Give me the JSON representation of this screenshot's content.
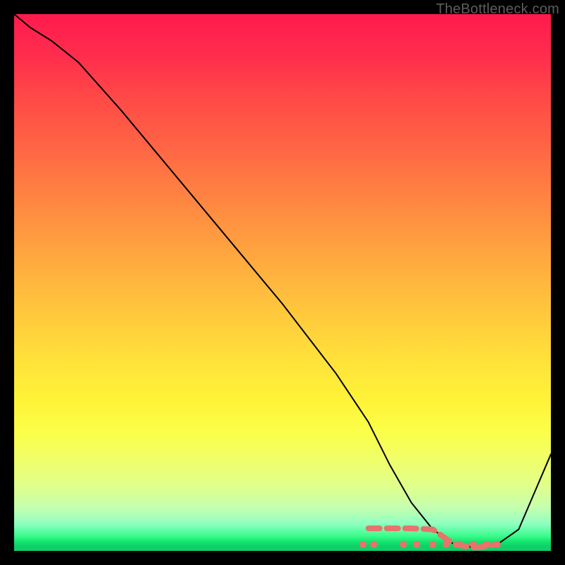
{
  "watermark": "TheBottleneck.com",
  "chart_data": {
    "type": "line",
    "title": "",
    "xlabel": "",
    "ylabel": "",
    "xlim": [
      0,
      100
    ],
    "ylim": [
      0,
      100
    ],
    "series": [
      {
        "name": "curve",
        "x": [
          0,
          3,
          7,
          12,
          20,
          30,
          40,
          50,
          60,
          66,
          70,
          74,
          78,
          82,
          86,
          90,
          94,
          100
        ],
        "y": [
          100,
          97.5,
          95,
          91,
          82,
          70,
          58,
          46,
          33,
          24,
          16,
          9,
          4,
          1.2,
          0.6,
          1.2,
          4,
          18
        ]
      }
    ],
    "highlight_range_x": [
      65,
      90
    ],
    "highlight_color": "#e8736b",
    "highlight_y": 1.2,
    "highlight_dots_x": [
      65,
      67,
      72.5,
      75,
      78,
      80.5,
      83,
      85.5,
      88,
      90
    ],
    "gradient_stops": [
      {
        "pct": 0,
        "color": "#ff1a4d"
      },
      {
        "pct": 50,
        "color": "#ffcc3c"
      },
      {
        "pct": 80,
        "color": "#fbff49"
      },
      {
        "pct": 97,
        "color": "#3cfc8c"
      },
      {
        "pct": 100,
        "color": "#0fd068"
      }
    ]
  }
}
